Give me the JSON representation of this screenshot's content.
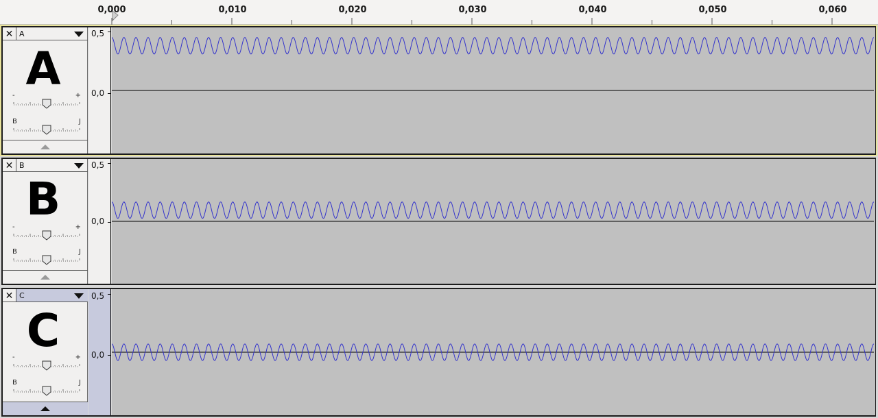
{
  "ruler": {
    "labels": [
      "0,000",
      "0,010",
      "0,020",
      "0,030",
      "0,040",
      "0,050",
      "0,060"
    ]
  },
  "tracks": [
    {
      "name": "A",
      "letter": "A",
      "selected": true,
      "gain_min": "-",
      "gain_max": "+",
      "gain_value": 0.5,
      "pan_left": "B",
      "pan_right": "J",
      "pan_value": 0.5,
      "scale_top": "0,5",
      "scale_mid": "0,0",
      "waveform": {
        "offset": 0.375,
        "amplitude": 0.07,
        "cycles": 63,
        "color": "#3333cc"
      }
    },
    {
      "name": "B",
      "letter": "B",
      "selected": false,
      "gain_min": "-",
      "gain_max": "+",
      "gain_value": 0.5,
      "pan_left": "B",
      "pan_right": "J",
      "pan_value": 0.5,
      "scale_top": "0,5",
      "scale_mid": "0,0",
      "waveform": {
        "offset": 0.095,
        "amplitude": 0.07,
        "cycles": 63,
        "color": "#3333cc"
      }
    },
    {
      "name": "C",
      "letter": "C",
      "selected": false,
      "focused": true,
      "gain_min": "-",
      "gain_max": "+",
      "gain_value": 0.5,
      "pan_left": "B",
      "pan_right": "J",
      "pan_value": 0.5,
      "scale_top": "0,5",
      "scale_mid": "0,0",
      "waveform": {
        "offset": 0.0,
        "amplitude": 0.07,
        "cycles": 63,
        "color": "#3333cc"
      }
    }
  ]
}
